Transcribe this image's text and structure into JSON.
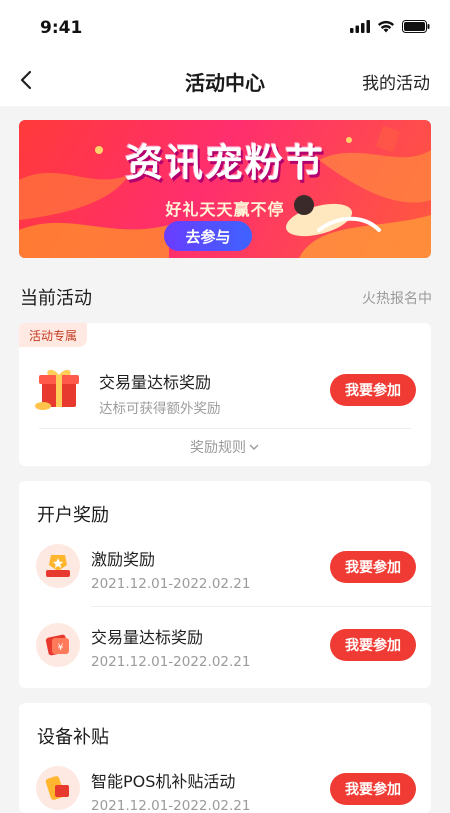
{
  "status_bar": {
    "time": "9:41"
  },
  "nav": {
    "title": "活动中心",
    "right_label": "我的活动"
  },
  "banner": {
    "title": "资讯宠粉节",
    "subtitle": "好礼天天赢不停",
    "button_label": "去参与"
  },
  "current_activities": {
    "title": "当前活动",
    "hint": "火热报名中",
    "card": {
      "tag": "活动专属",
      "title": "交易量达标奖励",
      "subtitle": "达标可获得额外奖励",
      "button_label": "我要参加",
      "rules_label": "奖励规则"
    }
  },
  "account_rewards": {
    "title": "开户奖励",
    "items": [
      {
        "title": "激励奖励",
        "date": "2021.12.01-2022.02.21",
        "button_label": "我要参加"
      },
      {
        "title": "交易量达标奖励",
        "date": "2021.12.01-2022.02.21",
        "button_label": "我要参加"
      }
    ]
  },
  "device_subsidy": {
    "title": "设备补贴",
    "items": [
      {
        "title": "智能POS机补贴活动",
        "date": "2021.12.01-2022.02.21",
        "button_label": "我要参加"
      }
    ]
  },
  "colors": {
    "accent": "#ef3b33",
    "tag_bg": "#ffe9e2",
    "background": "#f4f4f5"
  }
}
